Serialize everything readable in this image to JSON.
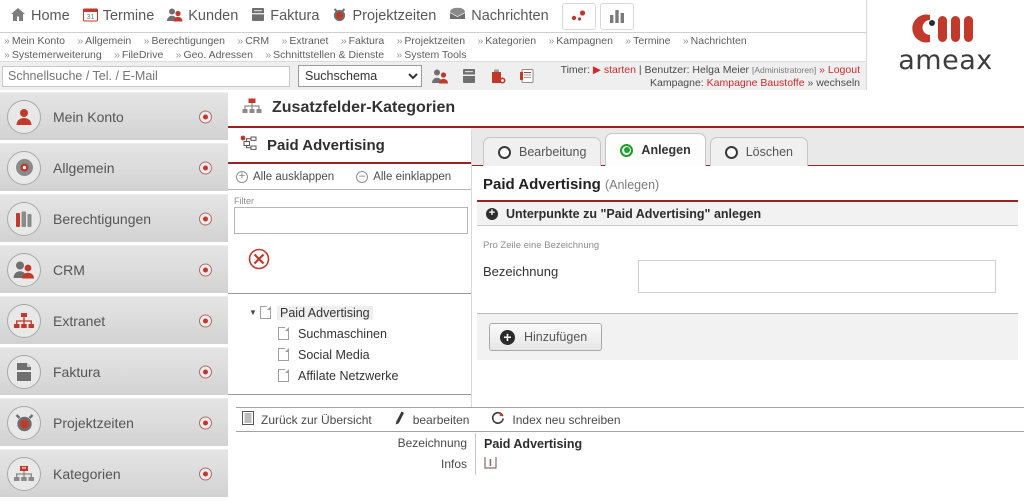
{
  "app": {
    "brand": "ameax",
    "accent": "#c0392b",
    "header_rule": "#9b2222"
  },
  "topnav": {
    "items": [
      {
        "label": "Home",
        "icon": "home-icon"
      },
      {
        "label": "Termine",
        "icon": "calendar-icon"
      },
      {
        "label": "Kunden",
        "icon": "users-icon"
      },
      {
        "label": "Faktura",
        "icon": "invoice-icon"
      },
      {
        "label": "Projektzeiten",
        "icon": "clock-icon"
      },
      {
        "label": "Nachrichten",
        "icon": "mail-icon"
      }
    ],
    "buttons": [
      {
        "name": "pin-board-icon"
      },
      {
        "name": "statistics-icon"
      }
    ]
  },
  "breadcrumbs": {
    "row1": [
      "Mein Konto",
      "Allgemein",
      "Berechtigungen",
      "CRM",
      "Extranet",
      "Faktura",
      "Projektzeiten",
      "Kategorien",
      "Kampagnen",
      "Termine",
      "Nachrichten"
    ],
    "row2": [
      "Systemerweiterung",
      "FileDrive",
      "Geo. Adressen",
      "Schnittstellen & Dienste",
      "System Tools"
    ],
    "chevron": "»"
  },
  "search": {
    "placeholder": "Schnellsuche / Tel. / E-Mail",
    "value": "",
    "schema_selected": "Suchschema",
    "schema_options": [
      "Suchschema"
    ],
    "icons": [
      "contact-search-icon",
      "invoice-search-icon",
      "company-search-icon",
      "document-search-icon"
    ]
  },
  "session": {
    "timer_label": "Timer:",
    "timer_action": "starten",
    "user_label": "Benutzer:",
    "user_name": "Helga Meier",
    "user_role": "[Administratoren]",
    "logout": "» Logout",
    "campaign_label": "Kampagne:",
    "campaign_name": "Kampagne Baustoffe",
    "campaign_switch": "» wechseln",
    "separator": "|"
  },
  "system_badge": {
    "label": "Systemerweiterung",
    "icon": "red-dot-icon"
  },
  "sidebar": {
    "items": [
      {
        "label": "Mein Konto",
        "icon": "person-icon"
      },
      {
        "label": "Allgemein",
        "icon": "gear-disc-icon"
      },
      {
        "label": "Berechtigungen",
        "icon": "books-icon"
      },
      {
        "label": "CRM",
        "icon": "two-people-icon"
      },
      {
        "label": "Extranet",
        "icon": "network-icon"
      },
      {
        "label": "Faktura",
        "icon": "document-icon"
      },
      {
        "label": "Projektzeiten",
        "icon": "alarm-clock-icon"
      },
      {
        "label": "Kategorien",
        "icon": "sitemap-icon"
      }
    ]
  },
  "page": {
    "title": "Zusatzfelder-Kategorien",
    "title_icon": "sitemap-icon"
  },
  "tree_panel": {
    "title": "Paid Advertising",
    "title_icon": "tree-node-icon",
    "expand_all": "Alle ausklappen",
    "collapse_all": "Alle einklappen",
    "filter_label": "Filter",
    "filter_value": "",
    "clear_icon": "clear-x-icon",
    "tree": [
      {
        "label": "Paid Advertising",
        "depth": 0,
        "expanded": true,
        "selected": true
      },
      {
        "label": "Suchmaschinen",
        "depth": 1,
        "expanded": false,
        "selected": false
      },
      {
        "label": "Social Media",
        "depth": 1,
        "expanded": false,
        "selected": false
      },
      {
        "label": "Affilate Netzwerke",
        "depth": 1,
        "expanded": false,
        "selected": false
      }
    ]
  },
  "tabs": [
    {
      "label": "Bearbeitung",
      "active": false
    },
    {
      "label": "Anlegen",
      "active": true
    },
    {
      "label": "Löschen",
      "active": false
    }
  ],
  "editor": {
    "heading": "Paid Advertising",
    "heading_suffix": "(Anlegen)",
    "section_title": "Unterpunkte zu \"Paid Advertising\" anlegen",
    "hint": "Pro Zeile eine Bezeichnung",
    "field_label": "Bezeichnung",
    "field_value": "",
    "submit_label": "Hinzufügen"
  },
  "actionbar": [
    {
      "label": "Zurück zur Übersicht",
      "icon": "list-icon"
    },
    {
      "label": "bearbeiten",
      "icon": "pencil-icon"
    },
    {
      "label": "Index neu schreiben",
      "icon": "refresh-icon"
    }
  ],
  "detail_rows": [
    {
      "label": "Bezeichnung",
      "value": "Paid Advertising",
      "type": "text"
    },
    {
      "label": "Infos",
      "value": "",
      "type": "icon",
      "icon": "info-book-icon"
    }
  ]
}
